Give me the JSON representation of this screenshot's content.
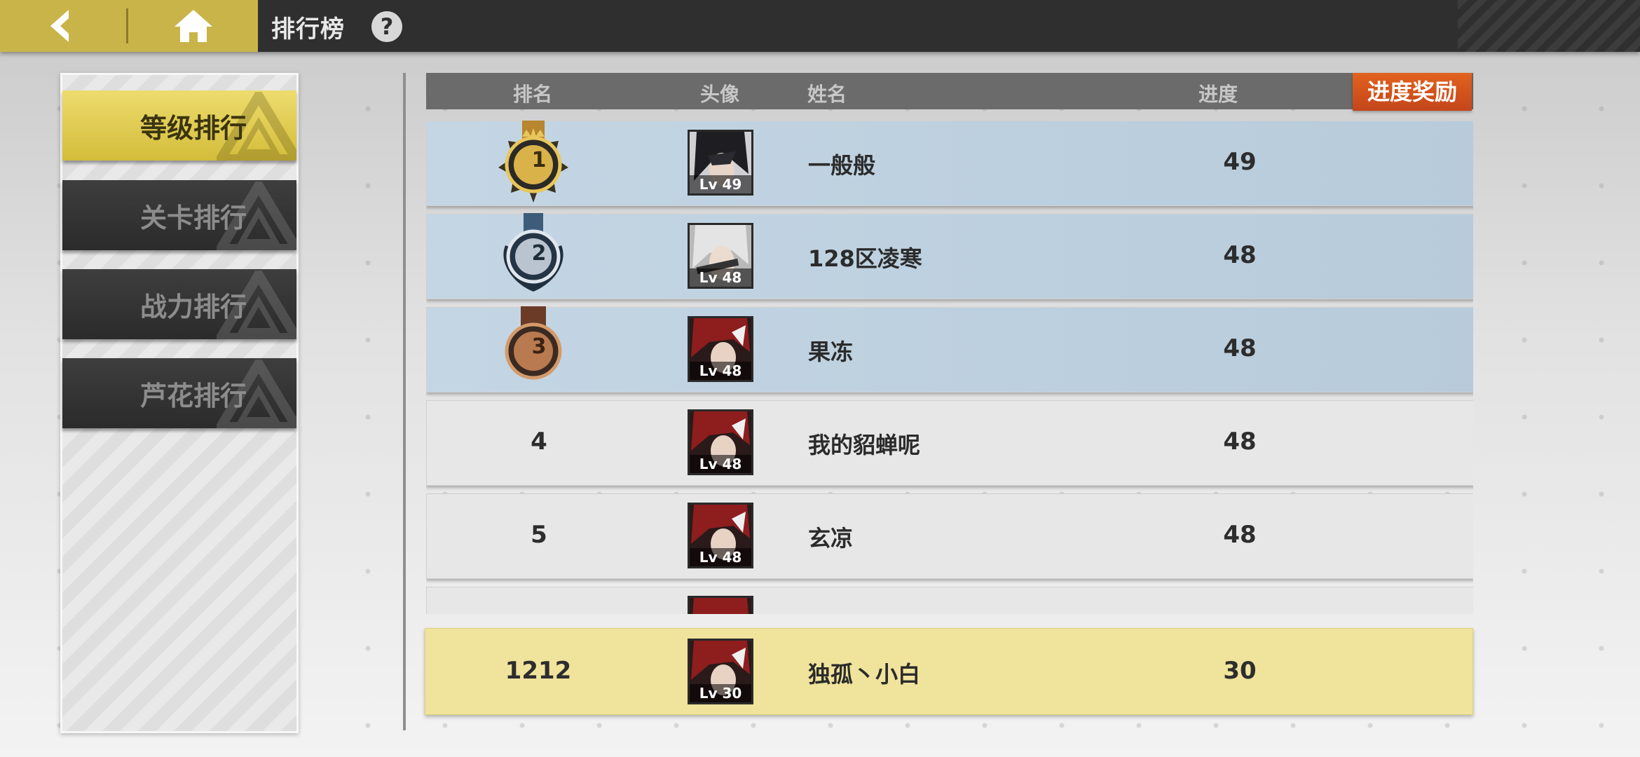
{
  "header": {
    "title": "排行榜",
    "help_symbol": "?"
  },
  "categories": [
    {
      "label": "等级排行",
      "active": true
    },
    {
      "label": "关卡排行",
      "active": false
    },
    {
      "label": "战力排行",
      "active": false
    },
    {
      "label": "芦花排行",
      "active": false
    }
  ],
  "list_header": {
    "rank": "排名",
    "avatar": "头像",
    "name": "姓名",
    "progress": "进度",
    "reward_button": "进度奖励"
  },
  "rows": [
    {
      "rank": "1",
      "medal": "gold",
      "name": "一般般",
      "progress": "49",
      "avatar_level": "Lv 49"
    },
    {
      "rank": "2",
      "medal": "silver",
      "name": "128区凌寒",
      "progress": "48",
      "avatar_level": "Lv 48"
    },
    {
      "rank": "3",
      "medal": "bronze",
      "name": "果冻",
      "progress": "48",
      "avatar_level": "Lv 48"
    },
    {
      "rank": "4",
      "medal": "",
      "name": "我的貂蝉呢",
      "progress": "48",
      "avatar_level": "Lv 48"
    },
    {
      "rank": "5",
      "medal": "",
      "name": "玄凉",
      "progress": "48",
      "avatar_level": "Lv 48"
    }
  ],
  "my_row": {
    "rank": "1212",
    "name": "独孤丶小白",
    "progress": "30",
    "avatar_level": "Lv 30"
  },
  "colors": {
    "accent_gold": "#c9b44a",
    "reward_orange": "#d4521c",
    "top_row_blue": "#bdd0e0",
    "my_row_yellow": "#f0e39c"
  }
}
